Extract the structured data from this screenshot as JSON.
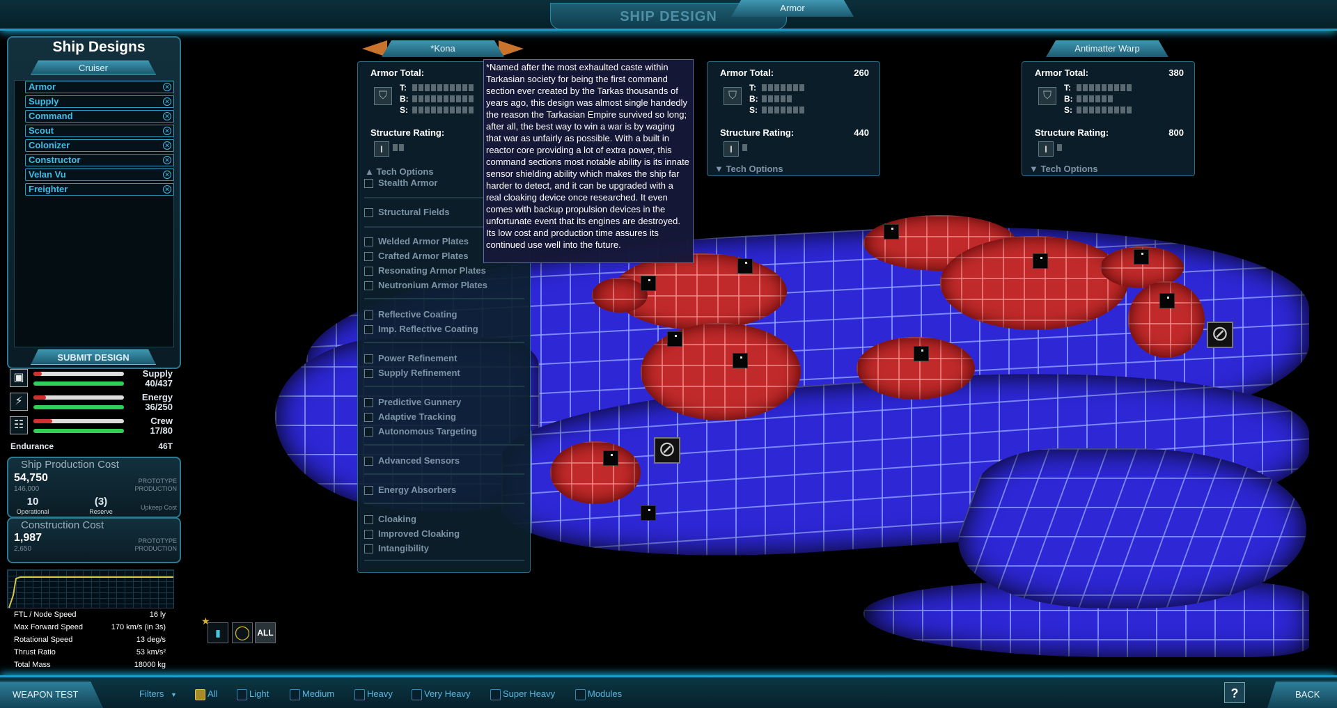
{
  "header": {
    "title": "SHIP DESIGN"
  },
  "designs_panel": {
    "title": "Ship Designs",
    "category": "Cruiser",
    "items": [
      "Armor",
      "Supply",
      "Command",
      "Scout",
      "Colonizer",
      "Constructor",
      "Velan Vu",
      "Freighter"
    ],
    "submit_label": "SUBMIT DESIGN"
  },
  "resources": {
    "supply": {
      "label": "Supply",
      "value": "40/437",
      "fraction": 0.09
    },
    "energy": {
      "label": "Energy",
      "value": "36/250",
      "fraction": 0.14
    },
    "crew": {
      "label": "Crew",
      "value": "17/80",
      "fraction": 0.21
    },
    "endurance": {
      "label": "Endurance",
      "value": "46T"
    }
  },
  "production": {
    "title": "Ship Production Cost",
    "cost": "54,750",
    "cost_sub": "146,000",
    "proto_label": "PROTOTYPE",
    "prod_label": "PRODUCTION",
    "operational": "10",
    "operational_label": "Operational",
    "reserve": "(3)",
    "reserve_label": "Reserve",
    "upkeep_label": "Upkeep Cost"
  },
  "construction": {
    "title": "Construction Cost",
    "cost": "1,987",
    "cost_sub": "2,650",
    "proto_label": "PROTOTYPE",
    "prod_label": "PRODUCTION"
  },
  "stats": [
    {
      "label": "FTL / Node Speed",
      "value": "16 ly"
    },
    {
      "label": "Max Forward Speed",
      "value": "170 km/s (in 3s)"
    },
    {
      "label": "Rotational Speed",
      "value": "13 deg/s"
    },
    {
      "label": "Thrust Ratio",
      "value": "53 km/s²"
    },
    {
      "label": "Total Mass",
      "value": "18000 kg"
    }
  ],
  "sections": [
    {
      "name": "*Kona",
      "armor_label": "Armor Total:",
      "armor_value": "",
      "t_label": "T:",
      "b_label": "B:",
      "s_label": "S:",
      "structure_label": "Structure Rating:",
      "structure_value": "",
      "tech_label": "Tech Options",
      "tech_items": [
        "Stealth Armor",
        "Structural Fields",
        "Welded Armor Plates",
        "Crafted Armor Plates",
        "Resonating Armor Plates",
        "Neutronium Armor Plates",
        "Reflective Coating",
        "Imp. Reflective Coating",
        "Power Refinement",
        "Supply Refinement",
        "Predictive Gunnery",
        "Adaptive Tracking",
        "Autonomous Targeting",
        "Advanced Sensors",
        "Energy Absorbers",
        "Cloaking",
        "Improved Cloaking",
        "Intangibility"
      ]
    },
    {
      "name": "Armor",
      "armor_label": "Armor Total:",
      "armor_value": "260",
      "t_label": "T:",
      "b_label": "B:",
      "s_label": "S:",
      "structure_label": "Structure Rating:",
      "structure_value": "440",
      "tech_label": "Tech Options"
    },
    {
      "name": "Antimatter Warp",
      "armor_label": "Armor Total:",
      "armor_value": "380",
      "t_label": "T:",
      "b_label": "B:",
      "s_label": "S:",
      "structure_label": "Structure Rating:",
      "structure_value": "800",
      "tech_label": "Tech Options"
    }
  ],
  "tooltip": {
    "text": "*Named after the most exhaulted caste within Tarkasian society for being the first command section ever created by the Tarkas thousands of years ago, this design was almost single handedly the reason the Tarkasian Empire survived so long; after all, the best way to win a war is by waging that war as unfairly as possible. With a built in reactor core providing a lot of extra power, this command sections most notable ability is its innate sensor shielding ability which makes the ship far harder to detect, and it can be upgraded with a real cloaking device once researched. It even comes with backup propulsion devices in the unfortunate event that its engines are destroyed. Its low cost and production time assures its continued use well into the future."
  },
  "view_controls": {
    "all_label": "ALL"
  },
  "bottom": {
    "weapon_test": "WEAPON TEST",
    "filters_label": "Filters",
    "filters": [
      "All",
      "Light",
      "Medium",
      "Heavy",
      "Very Heavy",
      "Super Heavy",
      "Modules"
    ],
    "help_label": "?",
    "back_label": "BACK"
  },
  "colors": {
    "accent": "#1a9ec4",
    "hull": "#2d27d6",
    "module": "#c12a2a",
    "link": "#3fbde8"
  }
}
